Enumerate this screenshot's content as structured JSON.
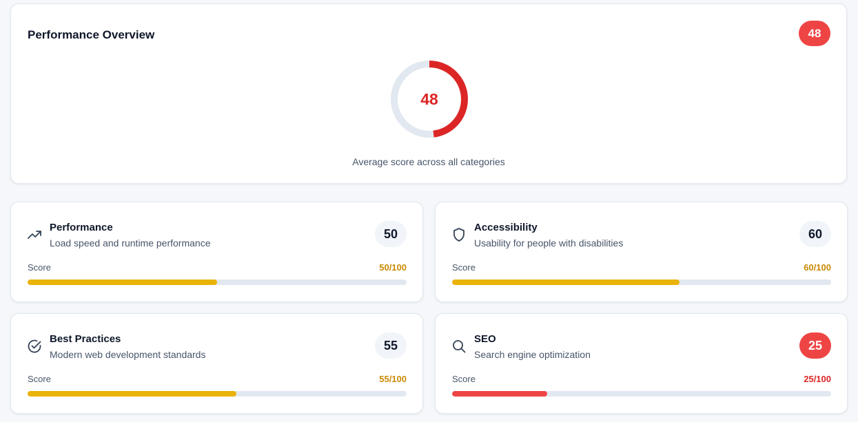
{
  "overview": {
    "title": "Performance Overview",
    "badge": "48",
    "ring_value": "48",
    "ring_fraction": 0.48,
    "caption": "Average score across all categories",
    "color": "#dc2626",
    "badge_color": "#ef4444",
    "track_color": "#e2e8f0"
  },
  "categories": [
    {
      "name": "Performance",
      "description": "Load speed and runtime performance",
      "icon": "trending-up-icon",
      "badge": "50",
      "score_label": "Score",
      "score_text": "50/100",
      "fraction": 0.5,
      "color": "#eab308",
      "text_color": "#ca8a04"
    },
    {
      "name": "Accessibility",
      "description": "Usability for people with disabilities",
      "icon": "shield-icon",
      "badge": "60",
      "score_label": "Score",
      "score_text": "60/100",
      "fraction": 0.6,
      "color": "#eab308",
      "text_color": "#ca8a04"
    },
    {
      "name": "Best Practices",
      "description": "Modern web development standards",
      "icon": "check-circle-icon",
      "badge": "55",
      "score_label": "Score",
      "score_text": "55/100",
      "fraction": 0.55,
      "color": "#eab308",
      "text_color": "#ca8a04"
    },
    {
      "name": "SEO",
      "description": "Search engine optimization",
      "icon": "search-icon",
      "badge": "25",
      "score_label": "Score",
      "score_text": "25/100",
      "fraction": 0.25,
      "color": "#ef4444",
      "text_color": "#dc2626"
    }
  ]
}
